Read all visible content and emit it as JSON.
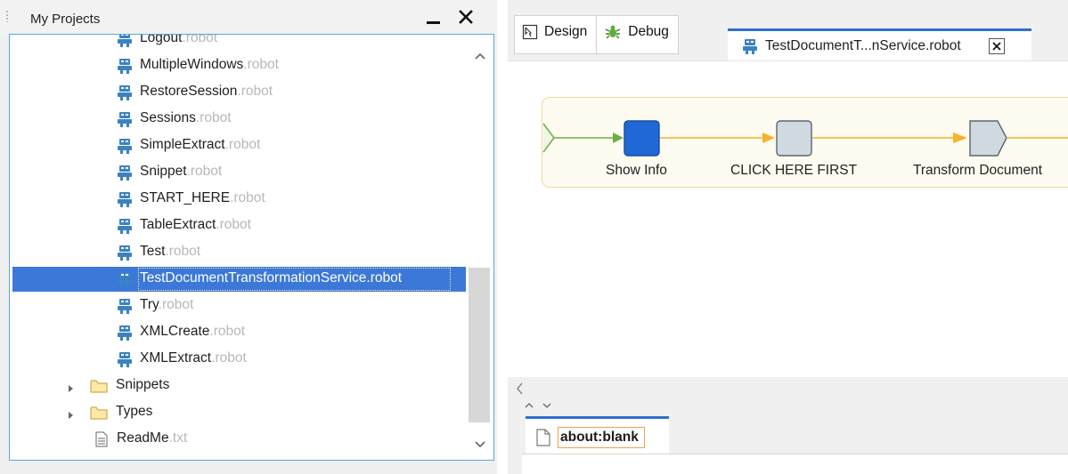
{
  "projects_panel": {
    "title": "My Projects",
    "robots": [
      {
        "name": "Logout",
        "ext": ".robot"
      },
      {
        "name": "MultipleWindows",
        "ext": ".robot"
      },
      {
        "name": "RestoreSession",
        "ext": ".robot"
      },
      {
        "name": "Sessions",
        "ext": ".robot"
      },
      {
        "name": "SimpleExtract",
        "ext": ".robot"
      },
      {
        "name": "Snippet",
        "ext": ".robot"
      },
      {
        "name": "START_HERE",
        "ext": ".robot"
      },
      {
        "name": "TableExtract",
        "ext": ".robot"
      },
      {
        "name": "Test",
        "ext": ".robot"
      },
      {
        "name": "TestDocumentTransformationService.robot",
        "ext": ""
      },
      {
        "name": "Try",
        "ext": ".robot"
      },
      {
        "name": "XMLCreate",
        "ext": ".robot"
      },
      {
        "name": "XMLExtract",
        "ext": ".robot"
      }
    ],
    "selected_index": 9,
    "folders": [
      {
        "name": "Snippets",
        "icon": "folder-icon"
      },
      {
        "name": "Types",
        "icon": "folder-icon"
      }
    ],
    "files": [
      {
        "name": "ReadMe",
        "ext": ".txt",
        "icon": "text-file-icon"
      }
    ]
  },
  "editor": {
    "mode_tabs": [
      {
        "label": "Design",
        "icon": "design-icon"
      },
      {
        "label": "Debug",
        "icon": "bug-icon"
      }
    ],
    "document_tab": {
      "label": "TestDocumentT...nService.robot",
      "icon": "robot-icon"
    },
    "flow_steps": [
      {
        "label": "Show Info"
      },
      {
        "label": "CLICK HERE FIRST"
      },
      {
        "label": "Transform Document"
      }
    ]
  },
  "browser": {
    "tab_label": "about:blank",
    "tab_icon": "page-icon"
  },
  "colors": {
    "selection": "#3b78d8",
    "accent_blue": "#2f6fd1",
    "flow_arrow": "#f3b32a",
    "flow_start": "#6fae45",
    "ext_gray": "#b7b7b7"
  }
}
